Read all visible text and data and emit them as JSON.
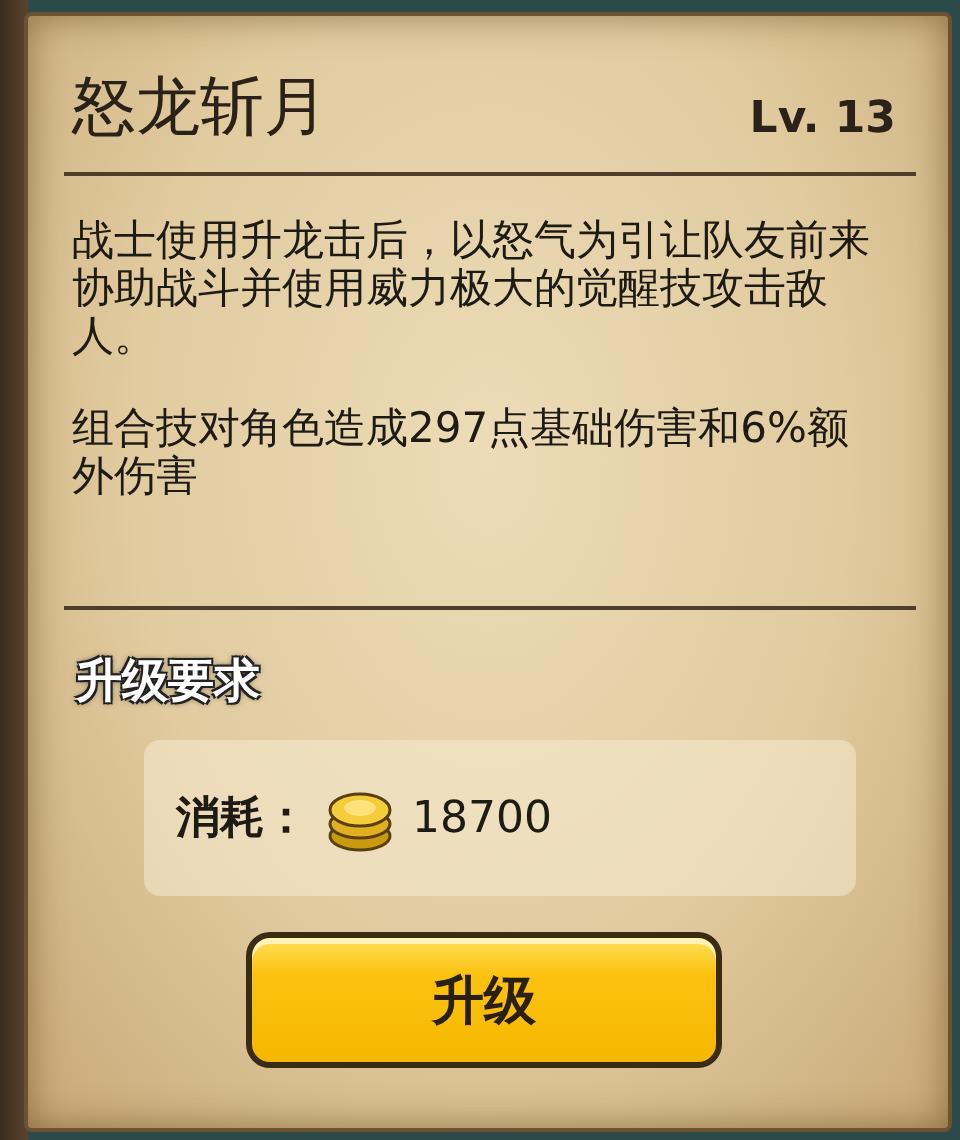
{
  "skill": {
    "name": "怒龙斩月",
    "level": "Lv. 13"
  },
  "description": [
    "战士使用升龙击后，以怒气为引让队友前来协助战斗并使用威力极大的觉醒技攻击敌人。",
    "组合技对角色造成297点基础伤害和6%额外伤害"
  ],
  "requirements": {
    "heading": "升级要求",
    "cost_label": "消耗：",
    "cost_amount": "18700"
  },
  "buttons": [
    {
      "label": "升级",
      "kind": "primary"
    }
  ]
}
